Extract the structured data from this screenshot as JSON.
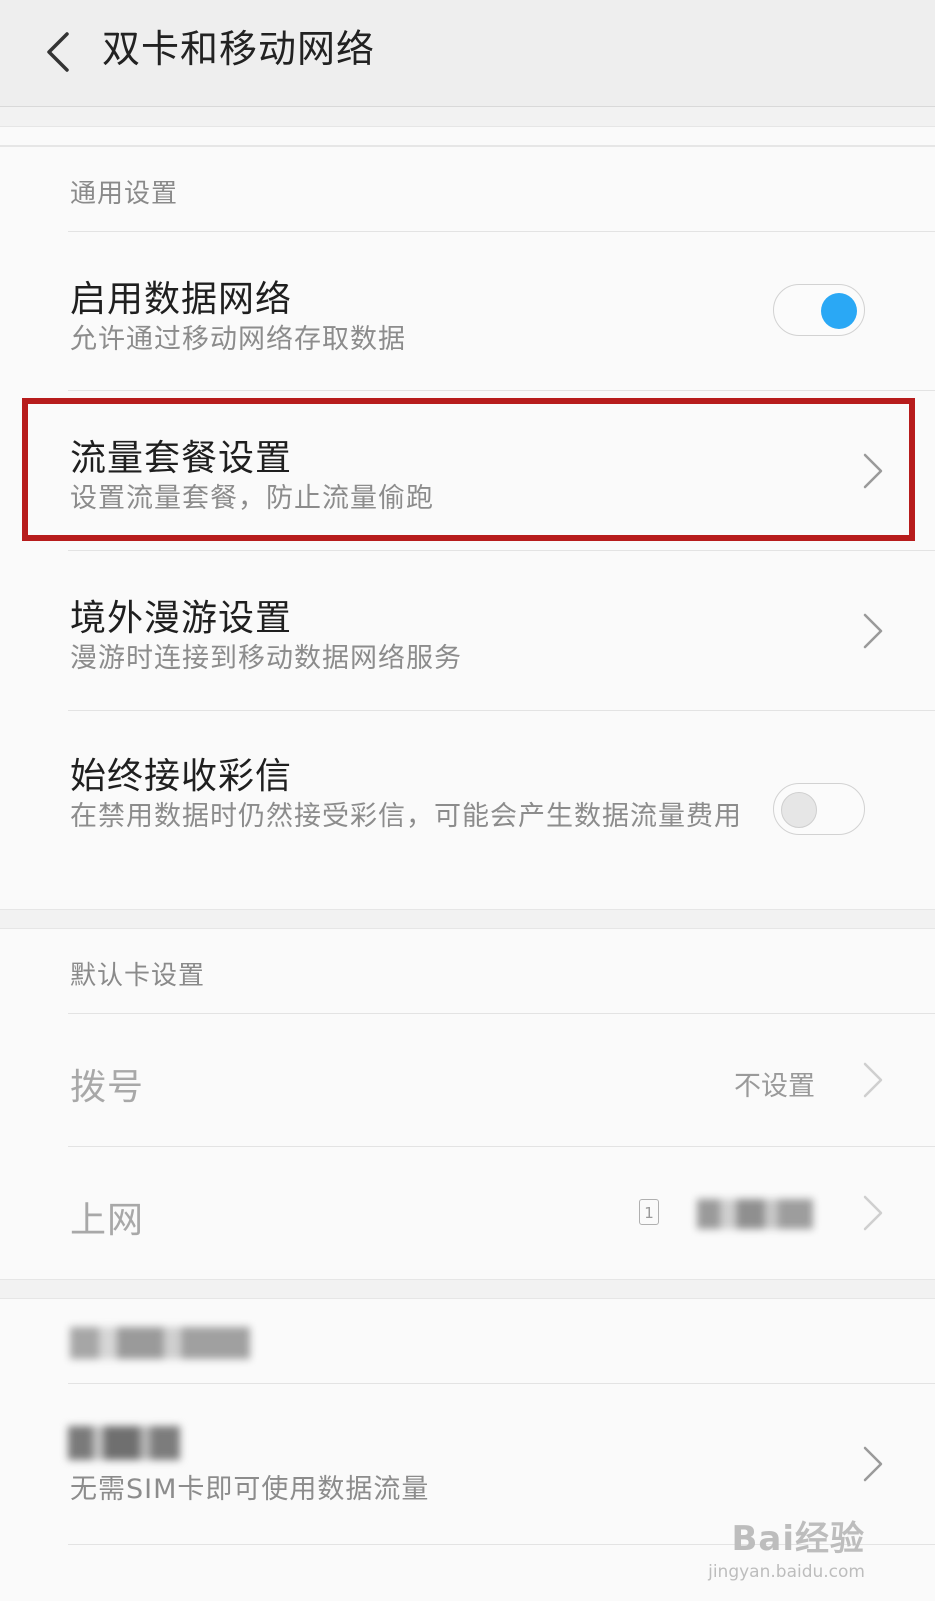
{
  "header": {
    "title": "双卡和移动网络",
    "back_icon": "chevron-left-icon"
  },
  "general": {
    "section_label": "通用设置",
    "data_network": {
      "title": "启用数据网络",
      "subtitle": "允许通过移动网络存取数据",
      "enabled": true
    },
    "data_plan": {
      "title": "流量套餐设置",
      "subtitle": "设置流量套餐，防止流量偷跑"
    },
    "roaming": {
      "title": "境外漫游设置",
      "subtitle": "漫游时连接到移动数据网络服务"
    },
    "mms": {
      "title": "始终接收彩信",
      "subtitle": "在禁用数据时仍然接受彩信，可能会产生数据流量费用",
      "enabled": false
    }
  },
  "default_card": {
    "section_label": "默认卡设置",
    "dial": {
      "title": "拨号",
      "value": "不设置"
    },
    "internet": {
      "title": "上网",
      "sim_badge": "1"
    }
  },
  "third": {
    "subtitle": "无需SIM卡即可使用数据流量"
  },
  "watermark": {
    "brand": "Bai经验",
    "url": "jingyan.baidu.com"
  },
  "colors": {
    "accent": "#2aa8f5",
    "highlight": "#b71c1c"
  }
}
